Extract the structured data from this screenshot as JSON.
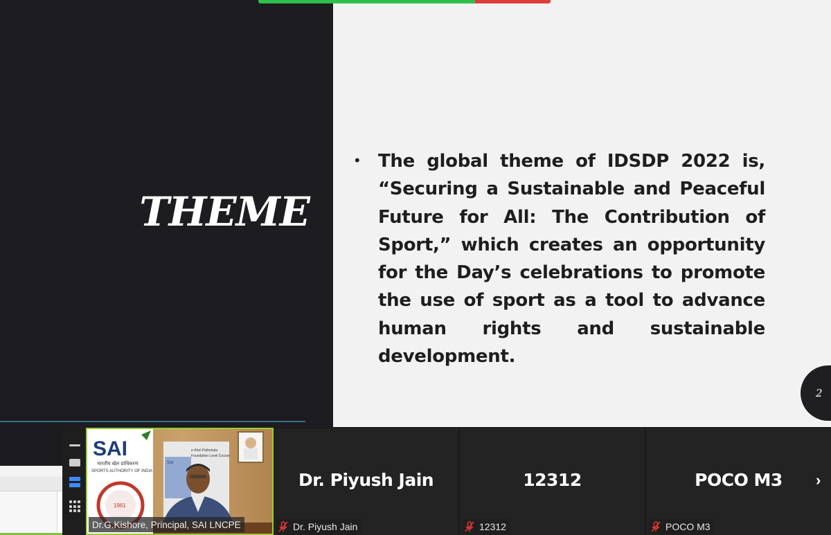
{
  "slide": {
    "title": "THEME",
    "bullet": "The global theme of IDSDP 2022 is, “Securing a Sustainable and Peaceful Future for All: The Contribution of Sport,” which creates an opportunity for the Day’s celebrations to promote the use of sport as a tool to advance human rights and sustainable development.",
    "page_number": "2"
  },
  "participants": {
    "video": {
      "name": "Dr.G.Kishore, Principal, SAI LNCPE",
      "banner_logo": "SAI",
      "banner_hindi": "भारतीय खेल प्राधिकरण",
      "banner_sub": "SPORTS AUTHORITY OF INDIA",
      "banner_year": "1961",
      "poster_text": "e-Khel Pathshala Foundation Level Course"
    },
    "tiles": [
      {
        "display_name": "Dr. Piyush Jain",
        "label": "Dr. Piyush Jain"
      },
      {
        "display_name": "12312",
        "label": "12312"
      },
      {
        "display_name": "POCO M3",
        "label": "POCO M3"
      }
    ]
  },
  "icons": {
    "muted": "mic-off-icon",
    "next": "chevron-right-icon"
  },
  "colors": {
    "active_speaker_border": "#9acd32",
    "indicator_green": "#2fbf4c",
    "indicator_red": "#e03c3c",
    "view_selected": "#3b8cff"
  }
}
